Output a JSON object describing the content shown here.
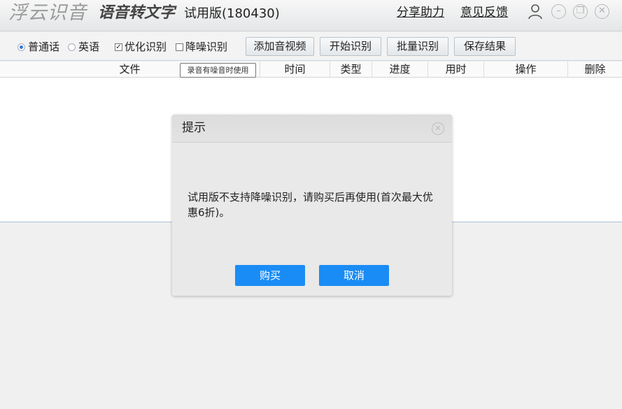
{
  "titlebar": {
    "brand": "浮云识音",
    "subtitle": "语音转文字",
    "edition": "试用版(180430)",
    "links": [
      "分享助力",
      "意见反馈"
    ]
  },
  "toolbar": {
    "options": [
      {
        "type": "radio",
        "label": "普通话",
        "checked": true
      },
      {
        "type": "radio",
        "label": "英语",
        "checked": false
      },
      {
        "type": "checkbox",
        "label": "优化识别",
        "checked": true
      },
      {
        "type": "checkbox",
        "label": "降噪识别",
        "checked": false
      }
    ],
    "buttons": [
      "添加音视频",
      "开始识别",
      "批量识别",
      "保存结果"
    ]
  },
  "table": {
    "columns": [
      "文件",
      "时间",
      "类型",
      "进度",
      "用时",
      "操作",
      "删除"
    ]
  },
  "tooltip": "录音有噪音时使用",
  "dialog": {
    "title": "提示",
    "message": "试用版不支持降噪识别，请购买后再使用(首次最大优惠6折)。",
    "buy_label": "购买",
    "cancel_label": "取消"
  },
  "colors": {
    "accent": "#1a8cf5",
    "radio_selected": "#2f7bd6"
  }
}
